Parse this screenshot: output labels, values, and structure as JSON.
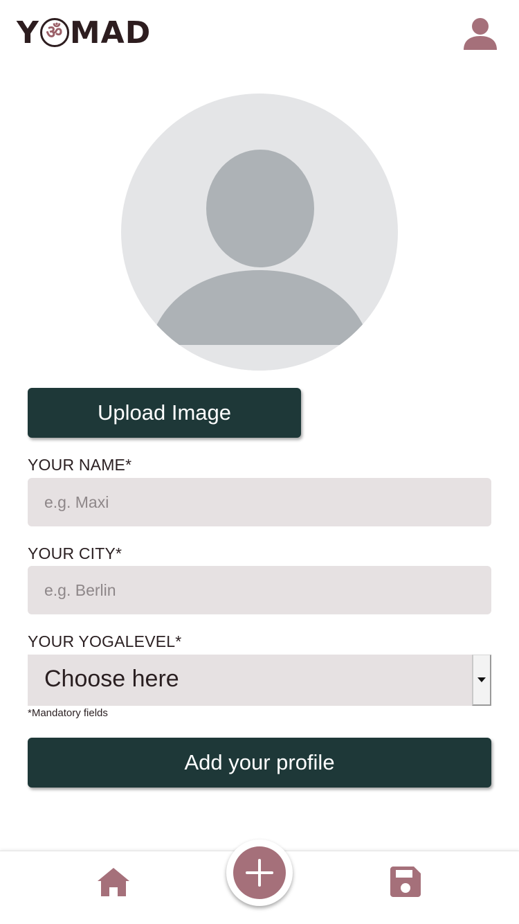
{
  "header": {
    "logo_prefix": "Y",
    "logo_symbol": "ॐ",
    "logo_suffix": "MAD",
    "profile_icon": "user-icon"
  },
  "avatar": {
    "icon": "avatar-placeholder-icon"
  },
  "upload_button": {
    "label": "Upload Image"
  },
  "form": {
    "name": {
      "label": "YOUR NAME*",
      "placeholder": "e.g. Maxi",
      "value": ""
    },
    "city": {
      "label": "YOUR CITY*",
      "placeholder": "e.g. Berlin",
      "value": ""
    },
    "yogalevel": {
      "label": "YOUR YOGALEVEL*",
      "selected": "Choose here"
    },
    "mandatory_note": "*Mandatory fields"
  },
  "submit_button": {
    "label": "Add your profile"
  },
  "bottom_nav": {
    "home_icon": "home-icon",
    "add_icon": "plus-icon",
    "save_icon": "floppy-disk-icon"
  },
  "colors": {
    "brand_dark": "#1e3838",
    "accent_mauve": "#a5707a",
    "input_bg": "#e6e1e2",
    "avatar_bg": "#e4e5e7",
    "avatar_fg": "#adb2b6",
    "text_dark": "#2a1f21"
  }
}
